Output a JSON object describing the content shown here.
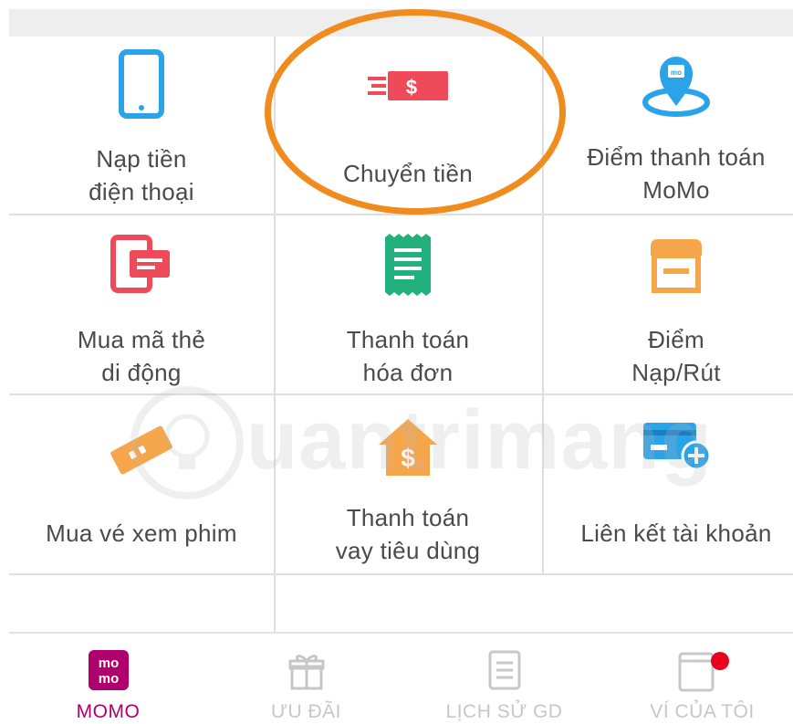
{
  "services": [
    {
      "name": "top-up",
      "lines": [
        "Nạp tiền",
        "điện thoại"
      ],
      "icon": "phone-icon"
    },
    {
      "name": "transfer",
      "lines": [
        "Chuyển tiền"
      ],
      "icon": "money-transfer-icon"
    },
    {
      "name": "payment-points",
      "lines": [
        "Điểm thanh toán",
        "MoMo"
      ],
      "icon": "map-pin-icon"
    },
    {
      "name": "mobile-card",
      "lines": [
        "Mua mã thẻ",
        "di động"
      ],
      "icon": "mobile-card-icon"
    },
    {
      "name": "pay-bills",
      "lines": [
        "Thanh toán",
        "hóa đơn"
      ],
      "icon": "bill-icon"
    },
    {
      "name": "cash-points",
      "lines": [
        "Điểm",
        "Nạp/Rút"
      ],
      "icon": "store-icon"
    },
    {
      "name": "movie-tickets",
      "lines": [
        "Mua vé xem phim"
      ],
      "icon": "ticket-icon"
    },
    {
      "name": "consumer-loan",
      "lines": [
        "Thanh toán",
        "vay tiêu dùng"
      ],
      "icon": "house-dollar-icon"
    },
    {
      "name": "link-account",
      "lines": [
        "Liên kết tài khoản"
      ],
      "icon": "card-add-icon"
    }
  ],
  "tabs": [
    {
      "label": "MOMO",
      "icon": "momo-logo-icon",
      "active": true,
      "logo_text": [
        "mo",
        "mo"
      ]
    },
    {
      "label": "ƯU ĐÃI",
      "icon": "gift-icon",
      "active": false
    },
    {
      "label": "LỊCH SỬ GD",
      "icon": "history-icon",
      "active": false
    },
    {
      "label": "VÍ CỦA TÔI",
      "icon": "wallet-icon",
      "active": false
    }
  ],
  "watermark": "uantrimang",
  "colors": {
    "brand": "#b0006d",
    "highlight": "#f08c1e",
    "phone": "#2aa3e8",
    "transfer": "#ef4a5a",
    "bill": "#22b07d",
    "store": "#f6a64a",
    "notification": "#e8001c"
  }
}
